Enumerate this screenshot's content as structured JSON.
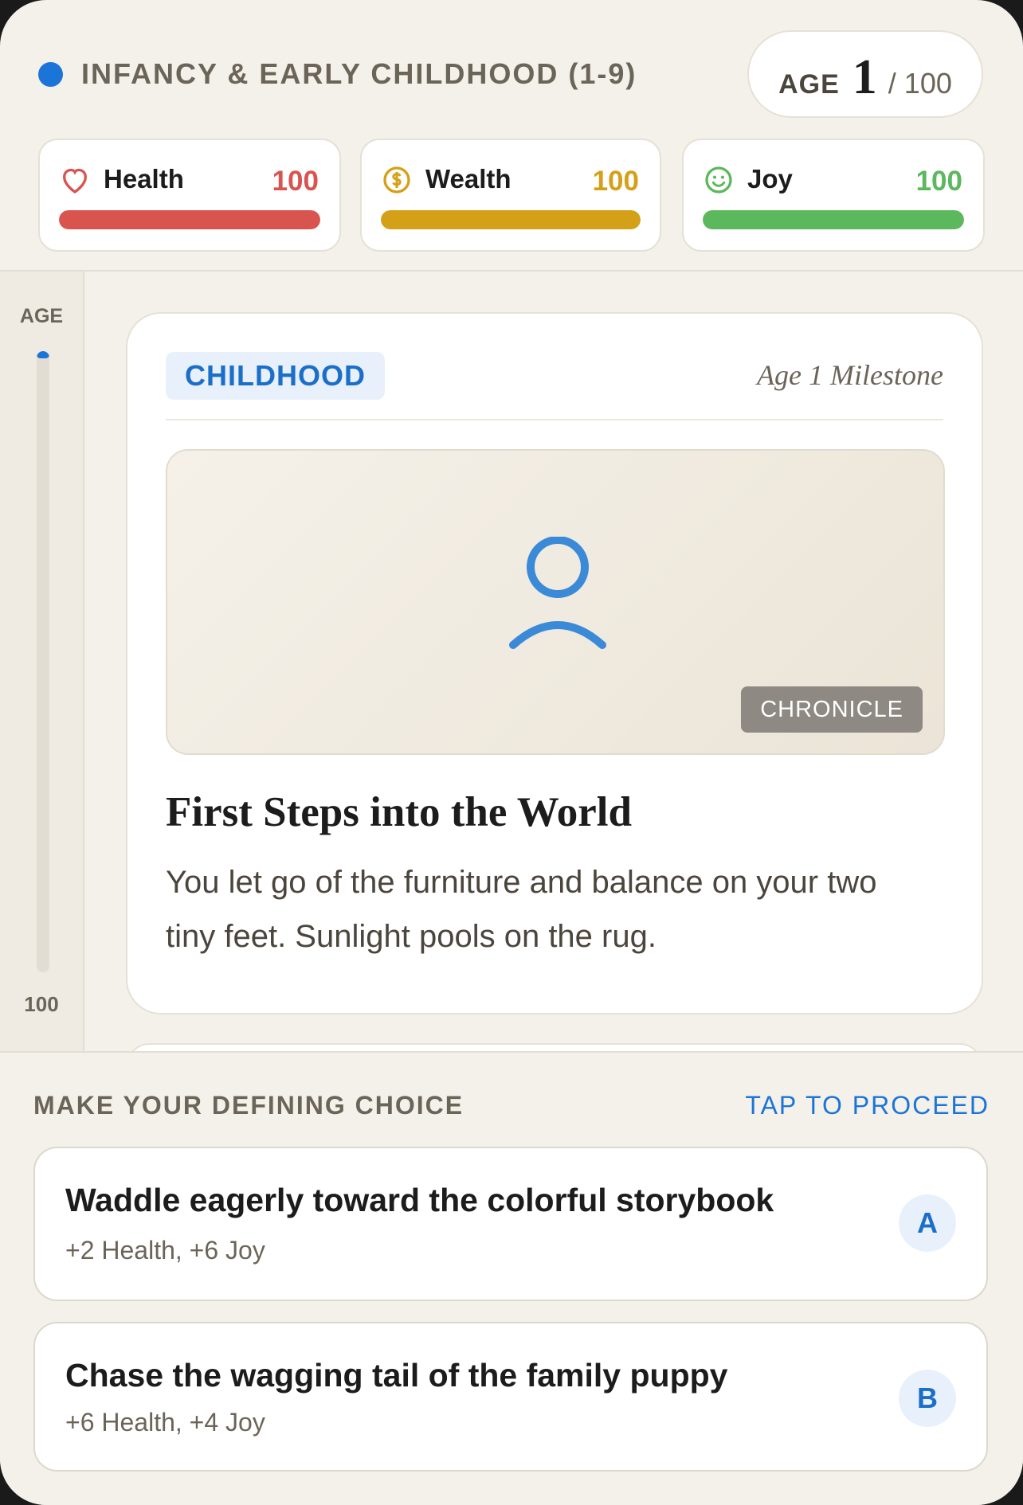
{
  "header": {
    "phase": "INFANCY & EARLY CHILDHOOD (1-9)",
    "age_label": "AGE",
    "age_value": "1",
    "age_max": "/ 100"
  },
  "stats": [
    {
      "name": "Health",
      "value": "100",
      "fill": 1.0,
      "color": "#d9534f",
      "icon": "heart-icon"
    },
    {
      "name": "Wealth",
      "value": "100",
      "fill": 1.0,
      "color": "#d4a017",
      "icon": "coin-icon"
    },
    {
      "name": "Joy",
      "value": "100",
      "fill": 1.0,
      "color": "#5cb85c",
      "icon": "smile-icon"
    }
  ],
  "rail": {
    "top_label": "AGE",
    "bottom_label": "100",
    "progress": 0.01
  },
  "event": {
    "tag": "CHILDHOOD",
    "milestone": "Age 1 Milestone",
    "illustration_icon": "person-icon",
    "chronicle": "CHRONICLE",
    "title": "First Steps into the World",
    "text": "You let go of the furniture and balance on your two tiny feet. Sunlight pools on the rug."
  },
  "choices_panel": {
    "label": "MAKE YOUR DEFINING CHOICE",
    "proceed": "TAP TO PROCEED",
    "choices": [
      {
        "title": "Waddle eagerly toward the colorful storybook",
        "effects": "+2 Health, +6 Joy",
        "key": "A"
      },
      {
        "title": "Chase the wagging tail of the family puppy",
        "effects": "+6 Health, +4 Joy",
        "key": "B"
      }
    ]
  },
  "colors": {
    "accent": "#1b74d8",
    "background": "#f4f1ea"
  }
}
